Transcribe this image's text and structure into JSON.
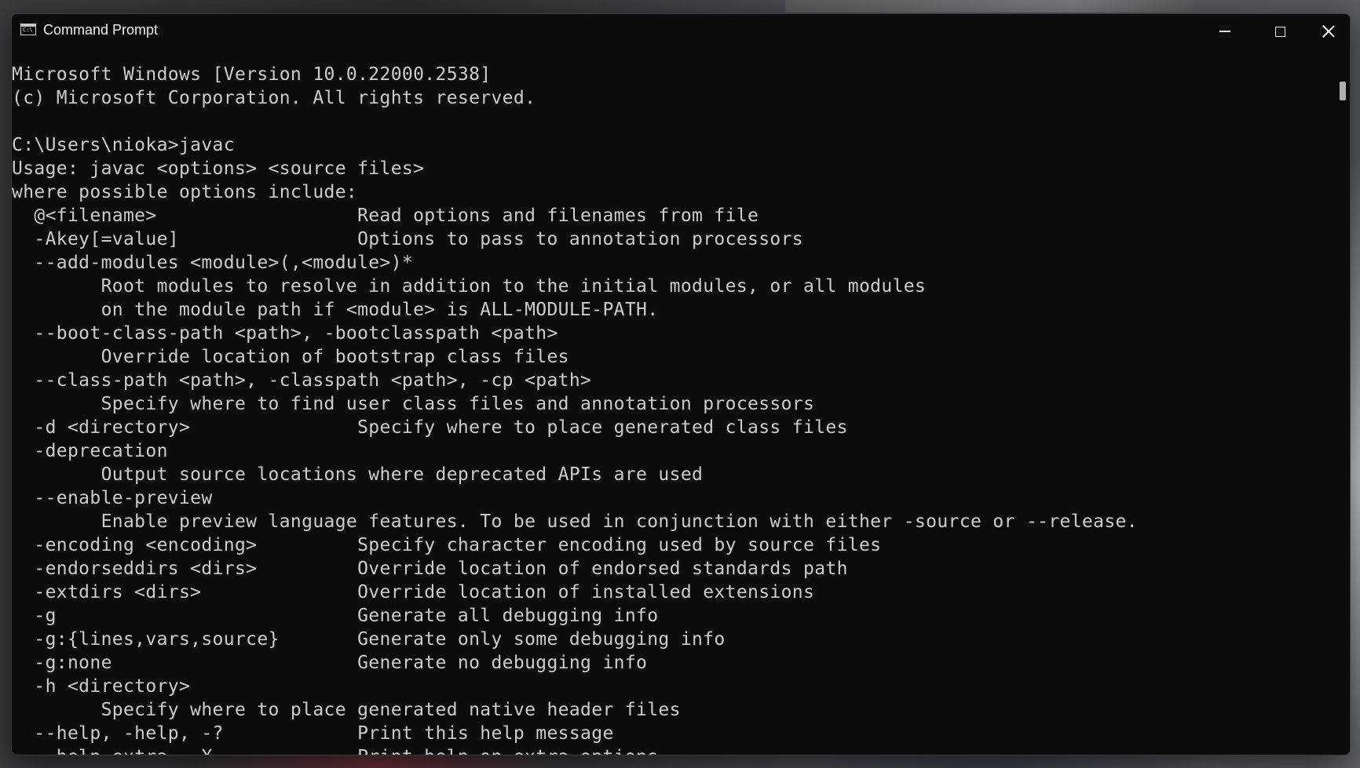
{
  "window": {
    "title": "Command Prompt",
    "icon": "console-icon",
    "icon_glyph": "C:\\",
    "controls": {
      "minimize": "minimize-icon",
      "maximize": "maximize-icon",
      "close": "close-icon"
    }
  },
  "console": {
    "lines": [
      "Microsoft Windows [Version 10.0.22000.2538]",
      "(c) Microsoft Corporation. All rights reserved.",
      "",
      "C:\\Users\\nioka>javac",
      "Usage: javac <options> <source files>",
      "where possible options include:",
      "  @<filename>                  Read options and filenames from file",
      "  -Akey[=value]                Options to pass to annotation processors",
      "  --add-modules <module>(,<module>)*",
      "        Root modules to resolve in addition to the initial modules, or all modules",
      "        on the module path if <module> is ALL-MODULE-PATH.",
      "  --boot-class-path <path>, -bootclasspath <path>",
      "        Override location of bootstrap class files",
      "  --class-path <path>, -classpath <path>, -cp <path>",
      "        Specify where to find user class files and annotation processors",
      "  -d <directory>               Specify where to place generated class files",
      "  -deprecation",
      "        Output source locations where deprecated APIs are used",
      "  --enable-preview",
      "        Enable preview language features. To be used in conjunction with either -source or --release.",
      "  -encoding <encoding>         Specify character encoding used by source files",
      "  -endorseddirs <dirs>         Override location of endorsed standards path",
      "  -extdirs <dirs>              Override location of installed extensions",
      "  -g                           Generate all debugging info",
      "  -g:{lines,vars,source}       Generate only some debugging info",
      "  -g:none                      Generate no debugging info",
      "  -h <directory>",
      "        Specify where to place generated native header files",
      "  --help, -help, -?            Print this help message",
      "  --help-extra, -X             Print help on extra options"
    ]
  },
  "colors": {
    "console_bg": "#0c0c0c",
    "console_fg": "#cccccc"
  }
}
